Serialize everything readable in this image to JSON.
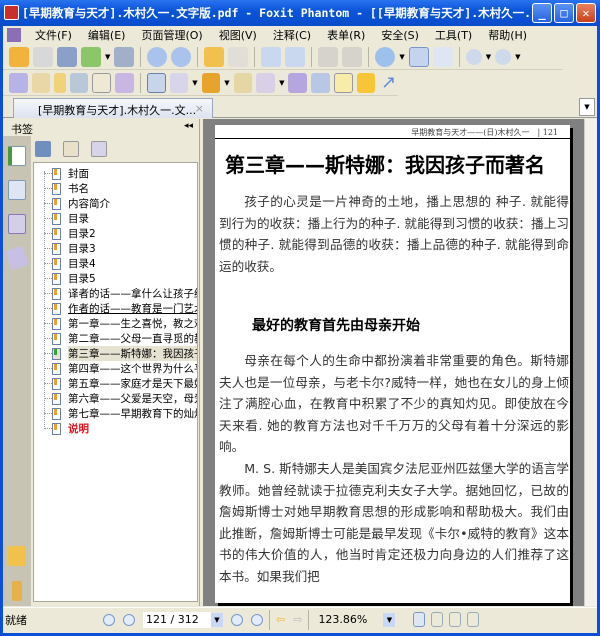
{
  "window": {
    "title": "[早期教育与天才].木村久一.文字版.pdf - Foxit Phantom - [[早期教育与天才].木村久一...",
    "min": "_",
    "max": "□",
    "close": "✕"
  },
  "menu": [
    "文件(F)",
    "编辑(E)",
    "页面管理(O)",
    "视图(V)",
    "注释(C)",
    "表单(R)",
    "安全(S)",
    "工具(T)",
    "帮助(H)"
  ],
  "toolbar1": [
    "open-folder",
    "save",
    "print",
    "email",
    "scan",
    "previous-page",
    "next-page",
    "back",
    "forward",
    "extract-page",
    "insert-page",
    "undo",
    "redo",
    "zoom-in-tool",
    "fit-page",
    "fit-width",
    "zoom-out",
    "zoom-in"
  ],
  "toolbar2": [
    "hand",
    "select-text",
    "select-annotation",
    "find",
    "typewriter",
    "snapshot",
    "rectangle",
    "pencil",
    "stamp",
    "attach",
    "security",
    "edit-note",
    "sign",
    "textbox",
    "comment",
    "arrow"
  ],
  "tab": {
    "label": "[早期教育与天才].木村久一.文...",
    "close": "×"
  },
  "bookmarks": {
    "header": "书签",
    "collapse": "◂◂",
    "items": [
      {
        "label": "封面"
      },
      {
        "label": "书名"
      },
      {
        "label": "内容简介"
      },
      {
        "label": "目录"
      },
      {
        "label": "目录2"
      },
      {
        "label": "目录3"
      },
      {
        "label": "目录4"
      },
      {
        "label": "目录5"
      },
      {
        "label": "译者的话——拿什么让孩子终身受益"
      },
      {
        "label": "作者的话——教育是一门艺术"
      },
      {
        "label": "第一章——生之喜悦，教之欢快"
      },
      {
        "label": "第二章——父母一直寻觅的教育"
      },
      {
        "label": "第三章——斯特娜：我因孩子而著名"
      },
      {
        "label": "第四章——这个世界为什么平庸"
      },
      {
        "label": "第五章——家庭才是天下最好的学校"
      },
      {
        "label": "第六章——父爱是天空，母爱是大地"
      },
      {
        "label": "第七章——早期教育下的灿烂之花"
      },
      {
        "label": "说明"
      }
    ]
  },
  "page": {
    "running_head": "早期教育与天才——(日)木村久一　| 121",
    "chapter_title": "第三章——斯特娜：我因孩子而著名",
    "para1": "孩子的心灵是一片神奇的土地，播上思想的 种子. 就能得到行为的收获：播上行为的种子. 就能得到习惯的收获：播上习惯的种子. 就能得到品德的收获：播上品德的种子. 就能得到命运的收获。",
    "subtitle": "最好的教育首先由母亲开始",
    "para2": "母亲在每个人的生命中都扮演着非常重要的角色。斯特娜夫人也是一位母亲，与老卡尔?威特一样，她也在女儿的身上倾注了满腔心血，在教育中积累了不少的真知灼见。即使放在今天来看. 她的教育方法也对千千万万的父母有着十分深远的影响。",
    "para3": "M. S. 斯特娜夫人是美国宾夕法尼亚州匹兹堡大学的语言学教师。她曾经就读于拉德克利夫女子大学。据她回忆，已故的詹姆斯博士对她早期教育思想的形成影响和帮助极大。我们由此推断，詹姆斯博士可能是最早发现《卡尔•威特的教育》这本书的伟大价值的人，他当时肯定还极力向身边的人们推荐了这本书。如果我们把"
  },
  "status": {
    "text": "就绪",
    "page": "121 / 312",
    "zoom": "123.86%"
  }
}
